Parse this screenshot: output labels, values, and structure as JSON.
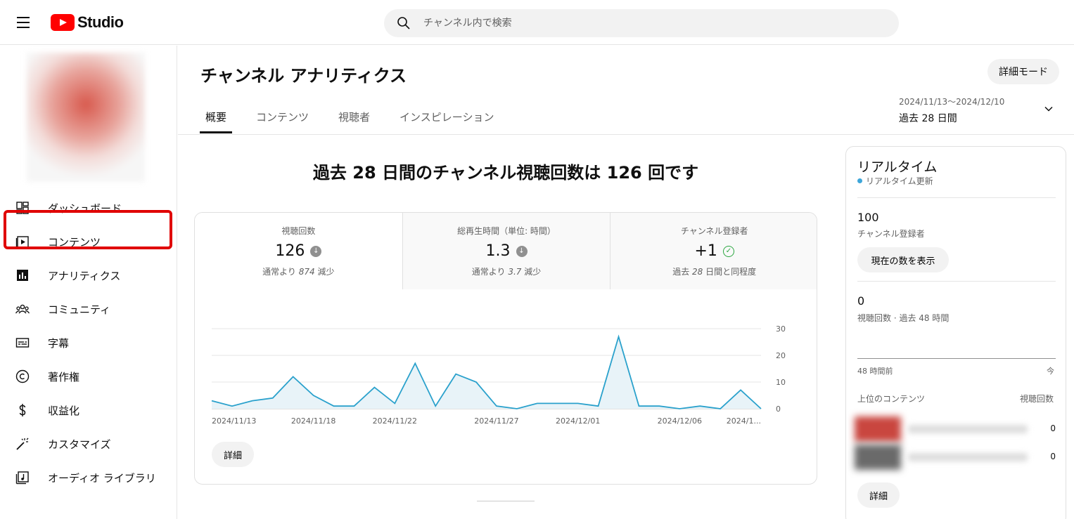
{
  "header": {
    "logo_text": "Studio",
    "search_placeholder": "チャンネル内で検索"
  },
  "sidebar": {
    "items": [
      {
        "label": "ダッシュボード",
        "icon": "dashboard-icon"
      },
      {
        "label": "コンテンツ",
        "icon": "content-icon"
      },
      {
        "label": "アナリティクス",
        "icon": "analytics-icon",
        "active": true
      },
      {
        "label": "コミュニティ",
        "icon": "community-icon"
      },
      {
        "label": "字幕",
        "icon": "subtitles-icon"
      },
      {
        "label": "著作権",
        "icon": "copyright-icon"
      },
      {
        "label": "収益化",
        "icon": "monetization-icon"
      },
      {
        "label": "カスタマイズ",
        "icon": "customization-icon"
      },
      {
        "label": "オーディオ ライブラリ",
        "icon": "audio-library-icon"
      }
    ]
  },
  "main": {
    "title": "チャンネル アナリティクス",
    "advanced_mode": "詳細モード",
    "tabs": [
      "概要",
      "コンテンツ",
      "視聴者",
      "インスピレーション"
    ],
    "date_range": {
      "dates": "2024/11/13〜2024/12/10",
      "label": "過去 28 日間"
    },
    "headline": "過去 28 日間のチャンネル視聴回数は 126 回です",
    "metrics": [
      {
        "label": "視聴回数",
        "value": "126",
        "trend": "down",
        "note_prefix": "通常より ",
        "note_num": "874",
        "note_suffix": " 減少"
      },
      {
        "label": "総再生時間（単位: 時間）",
        "value": "1.3",
        "trend": "down",
        "note_prefix": "通常より ",
        "note_num": "3.7",
        "note_suffix": " 減少"
      },
      {
        "label": "チャンネル登録者",
        "value": "+1",
        "trend": "same",
        "note_prefix": "過去 ",
        "note_num": "28",
        "note_suffix": " 日間と同程度"
      }
    ],
    "details_button": "詳細"
  },
  "chart_data": {
    "type": "area",
    "title": "",
    "xlabel": "",
    "ylabel": "",
    "ylim": [
      0,
      30
    ],
    "yticks": [
      "30",
      "20",
      "10",
      "0"
    ],
    "x_tick_labels": [
      "2024/11/13",
      "2024/11/18",
      "2024/11/22",
      "2024/11/27",
      "2024/12/01",
      "2024/12/06",
      "2024/1..."
    ],
    "x": [
      "11/13",
      "11/14",
      "11/15",
      "11/16",
      "11/17",
      "11/18",
      "11/19",
      "11/20",
      "11/21",
      "11/22",
      "11/23",
      "11/24",
      "11/25",
      "11/26",
      "11/27",
      "11/28",
      "11/29",
      "11/30",
      "12/01",
      "12/02",
      "12/03",
      "12/04",
      "12/05",
      "12/06",
      "12/07",
      "12/08",
      "12/09",
      "12/10"
    ],
    "series": [
      {
        "values": [
          3,
          1,
          3,
          4,
          12,
          5,
          1,
          1,
          8,
          2,
          17,
          1,
          13,
          10,
          1,
          0,
          2,
          2,
          2,
          1,
          27,
          1,
          1,
          0,
          1,
          0,
          7,
          0
        ]
      }
    ],
    "line_color": "#2aa1cc",
    "fill_color": "#e8f3f8"
  },
  "realtime": {
    "title": "リアルタイム",
    "subtitle": "リアルタイム更新",
    "subscribers_value": "100",
    "subscribers_label": "チャンネル登録者",
    "show_count_button": "現在の数を表示",
    "views_value": "0",
    "views_label": "視聴回数 · 過去 48 時間",
    "axis_left": "48 時間前",
    "axis_right": "今",
    "top_content_header": "上位のコンテンツ",
    "views_header": "視聴回数",
    "top_content": [
      {
        "views": "0"
      },
      {
        "views": "0"
      }
    ],
    "details_button": "詳細"
  },
  "colors": {
    "brand_red": "#ff0000",
    "highlight_red": "#e00000",
    "accent_blue": "#3ea6d9"
  }
}
